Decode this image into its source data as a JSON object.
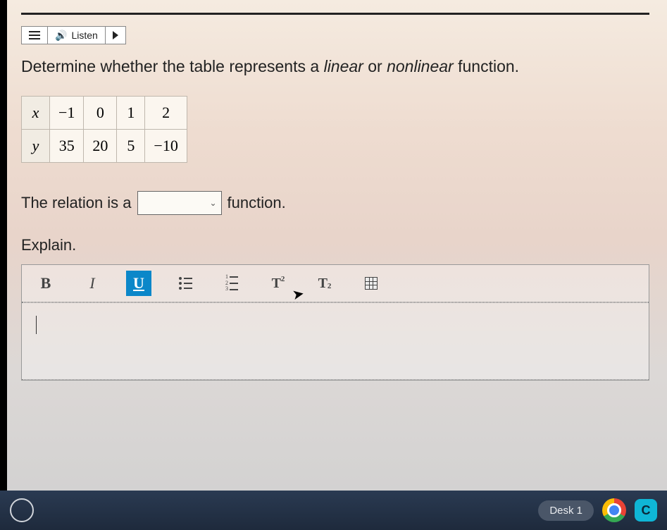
{
  "toolbar": {
    "listen_label": "Listen"
  },
  "question": {
    "prefix": "Determine whether the table represents a ",
    "word1": "linear",
    "middle": " or ",
    "word2": "nonlinear",
    "suffix": " function."
  },
  "table": {
    "row_labels": [
      "x",
      "y"
    ],
    "x": [
      "−1",
      "0",
      "1",
      "2"
    ],
    "y": [
      "35",
      "20",
      "5",
      "−10"
    ]
  },
  "answer": {
    "prefix": "The relation is a",
    "selected": "",
    "suffix": "function."
  },
  "explain_label": "Explain.",
  "editor": {
    "bold": "B",
    "italic": "I",
    "underline": "U",
    "superscript_base": "T",
    "superscript_exp": "2",
    "subscript_base": "T",
    "subscript_sub": "2"
  },
  "taskbar": {
    "desk_label": "Desk 1"
  }
}
